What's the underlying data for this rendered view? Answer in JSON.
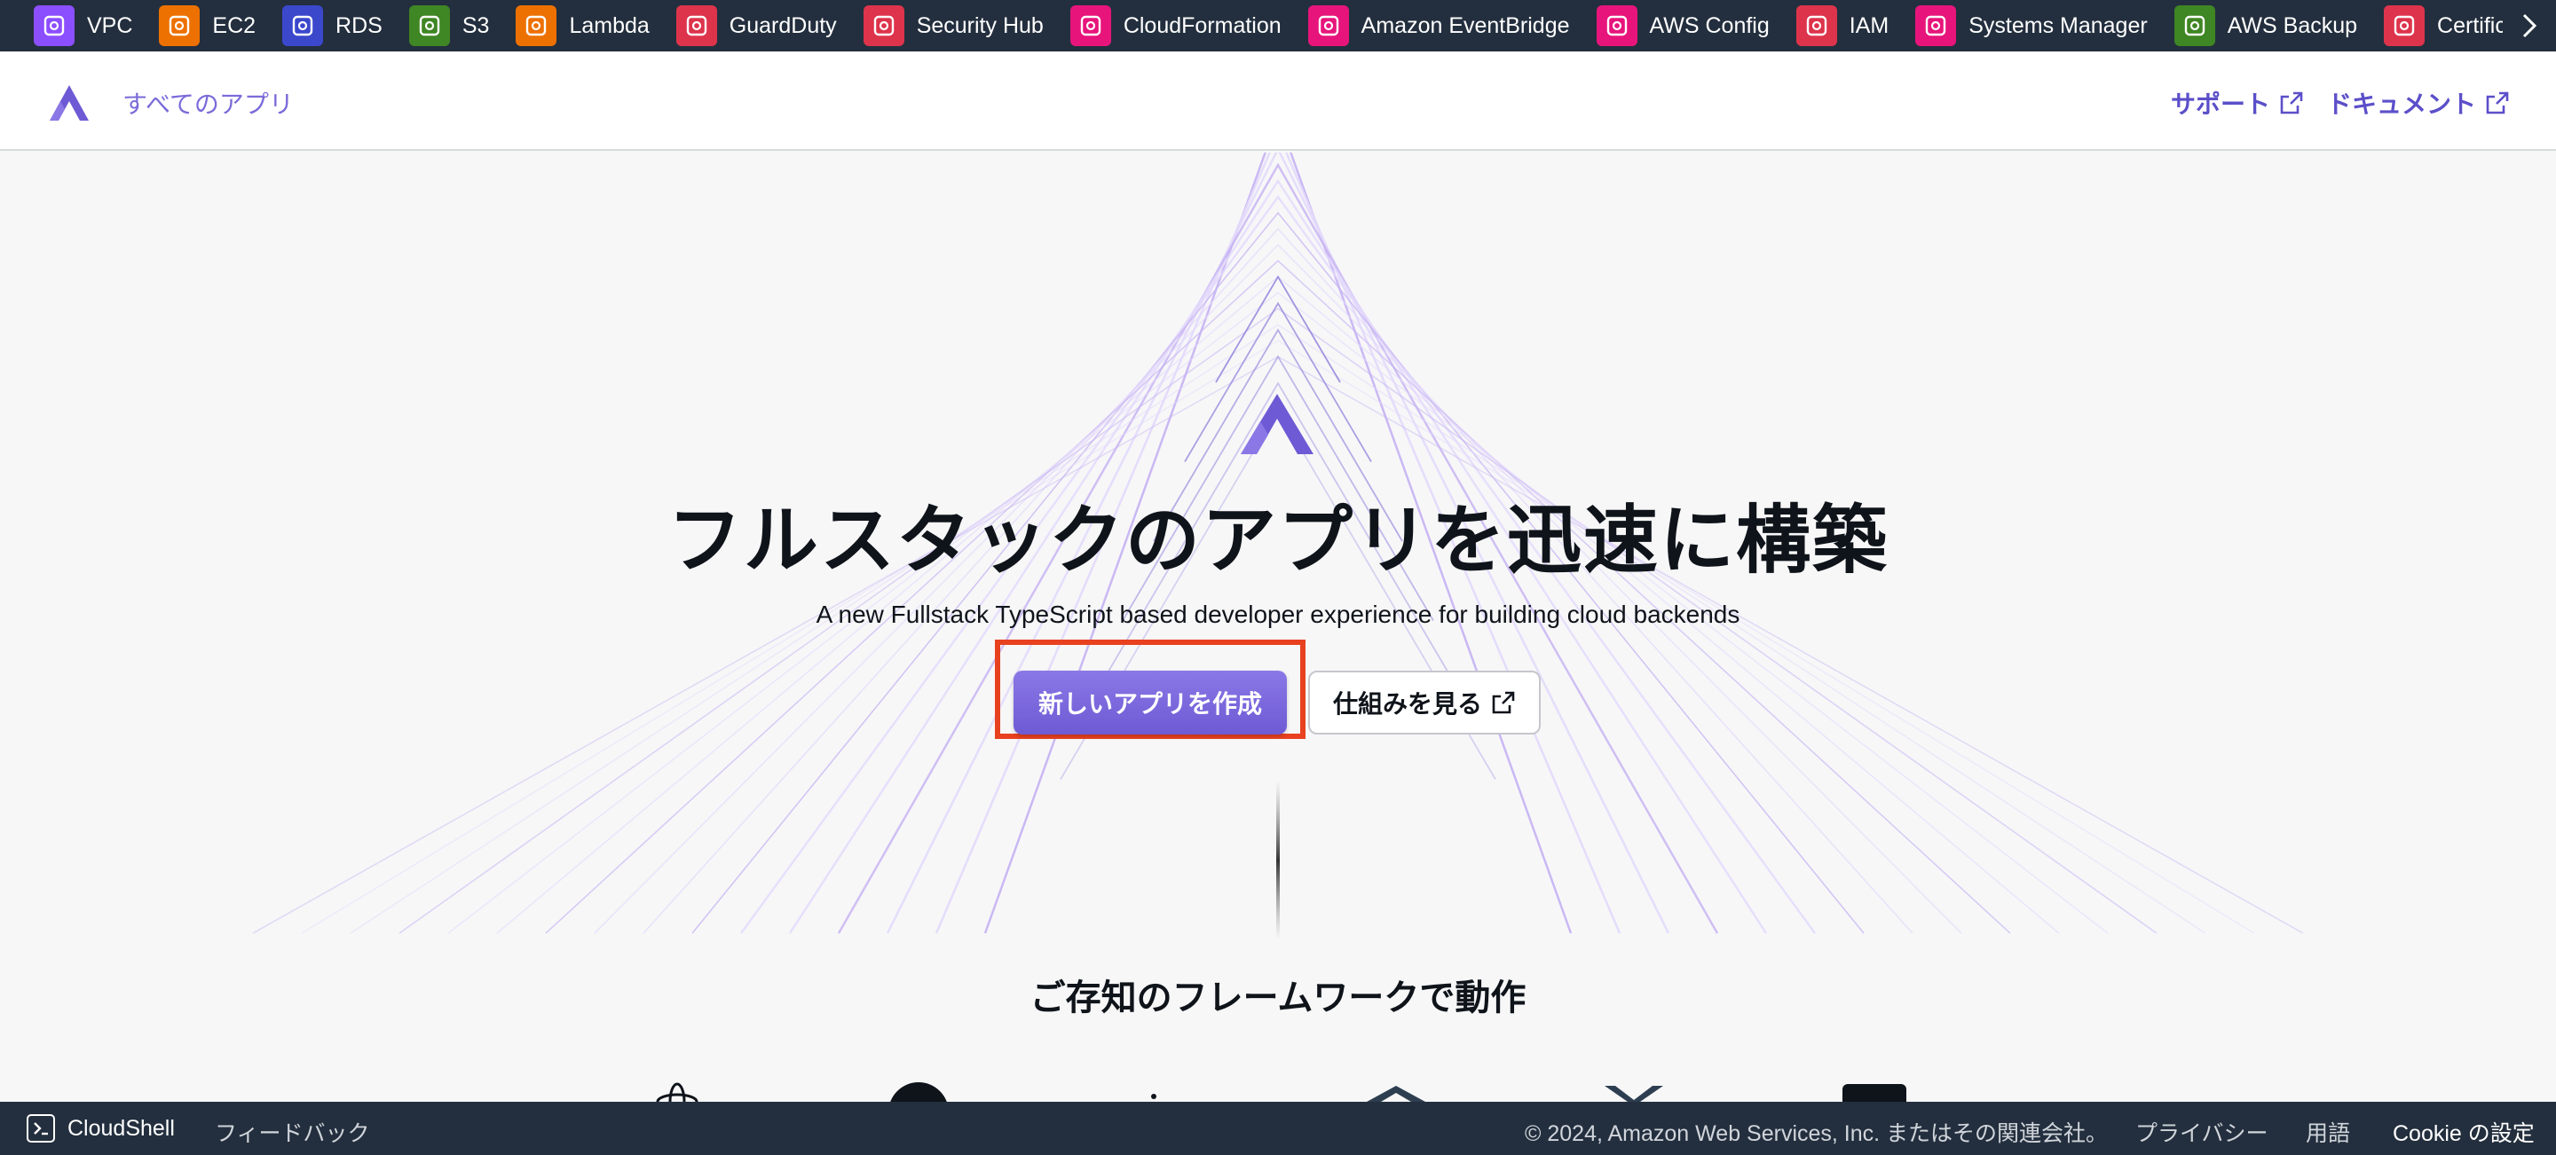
{
  "services": [
    {
      "label": "VPC",
      "icon": "vpc-icon",
      "color": "#8c4fff"
    },
    {
      "label": "EC2",
      "icon": "ec2-icon",
      "color": "#ed7100"
    },
    {
      "label": "RDS",
      "icon": "rds-icon",
      "color": "#3b48cc"
    },
    {
      "label": "S3",
      "icon": "s3-icon",
      "color": "#3f8624"
    },
    {
      "label": "Lambda",
      "icon": "lambda-icon",
      "color": "#ed7100"
    },
    {
      "label": "GuardDuty",
      "icon": "guardduty-icon",
      "color": "#dd344c"
    },
    {
      "label": "Security Hub",
      "icon": "security-hub-icon",
      "color": "#dd344c"
    },
    {
      "label": "CloudFormation",
      "icon": "cloudformation-icon",
      "color": "#e7157b"
    },
    {
      "label": "Amazon EventBridge",
      "icon": "eventbridge-icon",
      "color": "#e7157b"
    },
    {
      "label": "AWS Config",
      "icon": "aws-config-icon",
      "color": "#e7157b"
    },
    {
      "label": "IAM",
      "icon": "iam-icon",
      "color": "#dd344c"
    },
    {
      "label": "Systems Manager",
      "icon": "systems-manager-icon",
      "color": "#e7157b"
    },
    {
      "label": "AWS Backup",
      "icon": "aws-backup-icon",
      "color": "#3f8624"
    },
    {
      "label": "Certificat",
      "icon": "certificate-manager-icon",
      "color": "#dd344c"
    }
  ],
  "header": {
    "brand_label": "すべてのアプリ",
    "support_label": "サポート",
    "docs_label": "ドキュメント"
  },
  "hero": {
    "title": "フルスタックのアプリを迅速に構築",
    "subtitle": "A new Fullstack TypeScript based developer experience for building cloud backends",
    "primary_button": "新しいアプリを作成",
    "secondary_button": "仕組みを見る",
    "frameworks_title": "ご存知のフレームワークで動作"
  },
  "colors": {
    "accent": "#6e5ad4",
    "highlight": "#e8411f",
    "bar": "#232f3e"
  },
  "footer": {
    "cloudshell": "CloudShell",
    "feedback": "フィードバック",
    "copyright": "© 2024, Amazon Web Services, Inc. またはその関連会社。",
    "privacy": "プライバシー",
    "terms": "用語",
    "cookie": "Cookie の設定"
  }
}
